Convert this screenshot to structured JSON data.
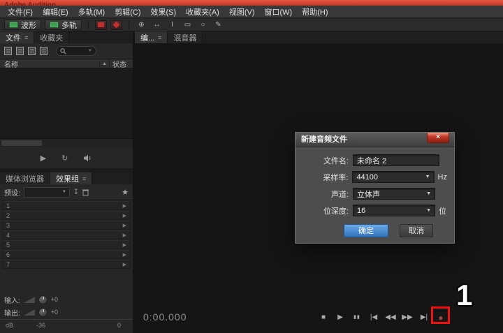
{
  "window": {
    "title": "Adobe Audition"
  },
  "menu": {
    "items": [
      "文件(F)",
      "编辑(E)",
      "多轨(M)",
      "剪辑(C)",
      "效果(S)",
      "收藏夹(A)",
      "视图(V)",
      "窗口(W)",
      "帮助(H)"
    ]
  },
  "toolbar": {
    "waveform": "波形",
    "multitrack": "多轨",
    "tools": {
      "move": "⊕",
      "slip": "↔",
      "ibeam": "I",
      "marquee": "▭",
      "lasso": "○",
      "brush": "✎"
    }
  },
  "files_panel": {
    "tab_files": "文件",
    "tab_favorites": "收藏夹",
    "col_name": "名称",
    "col_status": "状态"
  },
  "lower_panel": {
    "tab_media_browser": "媒体浏览器",
    "tab_effects_rack": "效果组",
    "presets_label": "预设:",
    "slots": [
      "1",
      "2",
      "3",
      "4",
      "5",
      "6",
      "7"
    ],
    "input_label": "输入:",
    "output_label": "输出:",
    "input_value": "+0",
    "output_value": "+0",
    "scale_db": "dB",
    "scale_mid": "-36",
    "scale_end": "0"
  },
  "editor": {
    "tab_editor": "编...",
    "tab_mixer": "混音器",
    "time": "0:00.000"
  },
  "transport": {
    "stop": "■",
    "play": "▶",
    "pause": "▮▮",
    "skip_start": "|◀",
    "rewind": "◀◀",
    "forward": "▶▶",
    "skip_end": "▶|",
    "record": "●"
  },
  "mini_transport": {
    "play": "▶",
    "loop": "↻"
  },
  "icons": {
    "panel_menu": "≡",
    "dropdown": "▼",
    "sort": "▲",
    "star": "★",
    "slot_arrow": "▶",
    "close": "×"
  },
  "dialog": {
    "title": "新建音频文件",
    "fields": {
      "filename_label": "文件名:",
      "filename_value": "未命名 2",
      "samplerate_label": "采样率:",
      "samplerate_value": "44100",
      "samplerate_unit": "Hz",
      "channels_label": "声道:",
      "channels_value": "立体声",
      "bitdepth_label": "位深度:",
      "bitdepth_value": "16",
      "bitdepth_unit": "位"
    },
    "ok": "确定",
    "cancel": "取消"
  },
  "annotation": {
    "step": "1"
  }
}
